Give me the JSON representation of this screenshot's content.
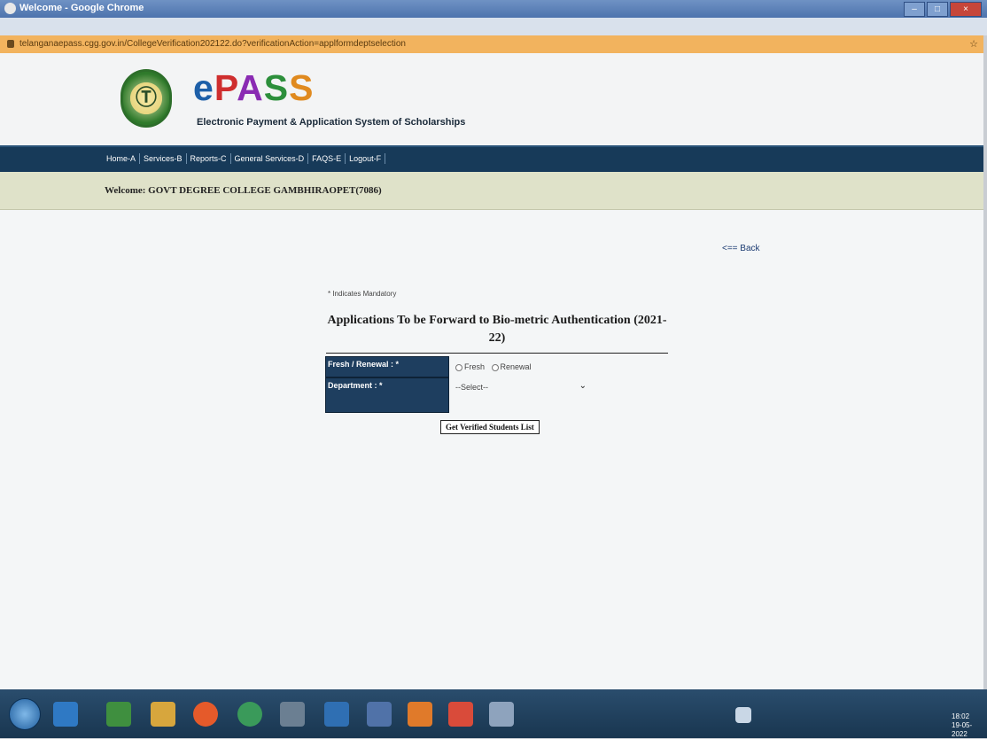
{
  "window": {
    "title": "Welcome - Google Chrome",
    "url": "telanganaepass.cgg.gov.in/CollegeVerification202122.do?verificationAction=applformdeptselection"
  },
  "header": {
    "logo_parts": [
      "e",
      "P",
      "A",
      "S",
      "S"
    ],
    "subtitle": "Electronic Payment & Application System of Scholarships",
    "emblem_colors": [
      "#2d6e2a",
      "#f5e9a6"
    ]
  },
  "nav": {
    "items": [
      "Home-A",
      "Services-B",
      "Reports-C",
      "General Services-D",
      "FAQS-E",
      "Logout-F"
    ]
  },
  "welcome": {
    "text": "Welcome: GOVT DEGREE COLLEGE GAMBHIRAOPET(7086)"
  },
  "back_link": "<== Back",
  "form": {
    "mandatory_note": "* Indicates Mandatory",
    "title": "Applications To be Forward to Bio-metric Authentication (2021-22)",
    "fresh_renewal_label": "Fresh / Renewal : *",
    "fresh_option": "Fresh",
    "renewal_option": "Renewal",
    "department_label": "Department : *",
    "department_select_value": "--Select--",
    "submit_label": "Get Verified Students List"
  },
  "taskbar": {
    "clock_time": "18:02",
    "clock_date": "19-05-2022"
  }
}
